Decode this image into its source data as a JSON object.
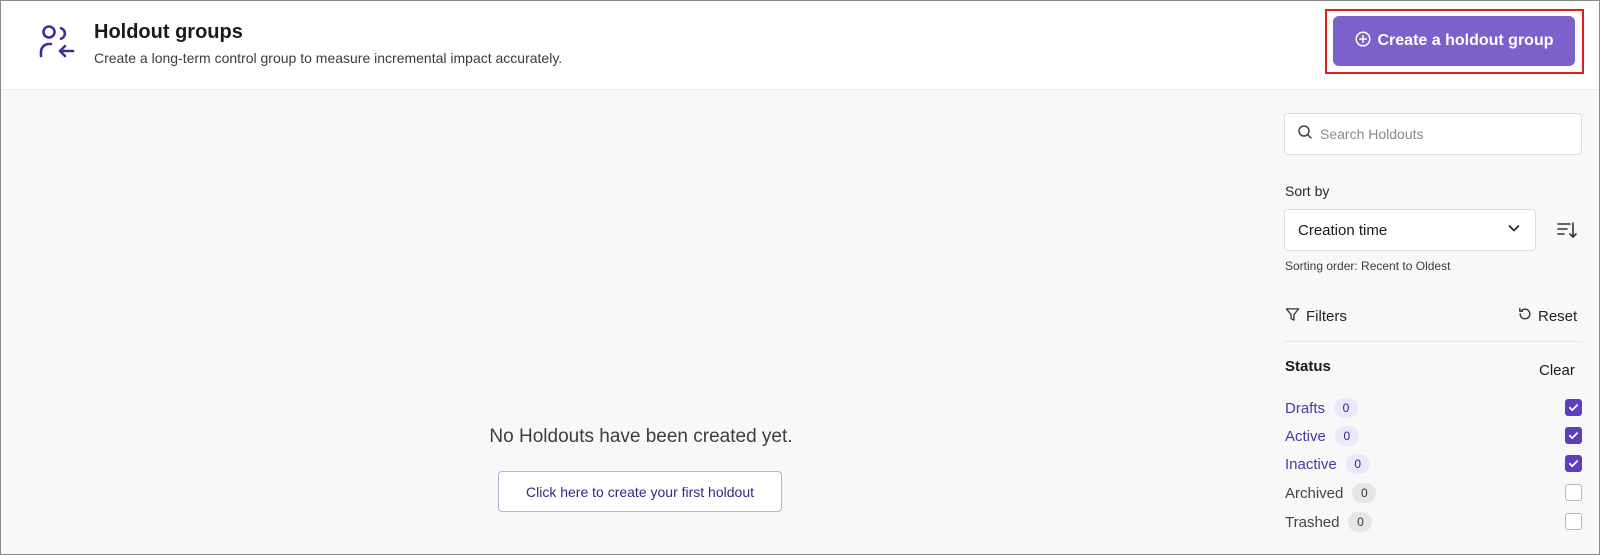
{
  "header": {
    "title": "Holdout groups",
    "subtitle": "Create a long-term control group to measure incremental impact accurately.",
    "icon": "users-arrow-icon",
    "create_button_label": "Create a holdout group"
  },
  "colors": {
    "accent": "#7b61c9",
    "checkbox_checked": "#5b3fc0",
    "highlight_border": "#e01e1e"
  },
  "main": {
    "empty_message": "No Holdouts have been created yet.",
    "empty_cta_label": "Click here to create your first holdout"
  },
  "sidebar": {
    "search_placeholder": "Search Holdouts",
    "sort_label": "Sort by",
    "sort_value": "Creation time",
    "sort_order_text": "Sorting order: Recent to Oldest",
    "filters_label": "Filters",
    "reset_label": "Reset",
    "status_label": "Status",
    "clear_label": "Clear",
    "statuses": [
      {
        "name": "Drafts",
        "count": "0",
        "checked": true
      },
      {
        "name": "Active",
        "count": "0",
        "checked": true
      },
      {
        "name": "Inactive",
        "count": "0",
        "checked": true
      },
      {
        "name": "Archived",
        "count": "0",
        "checked": false
      },
      {
        "name": "Trashed",
        "count": "0",
        "checked": false
      }
    ]
  }
}
